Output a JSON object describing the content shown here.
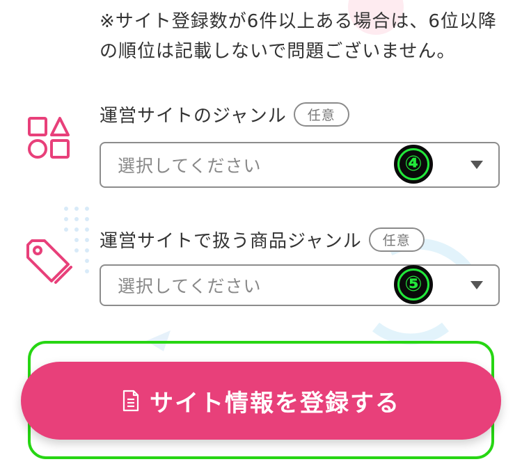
{
  "notice": "※サイト登録数が6件以上ある場合は、6位以降の順位は記載しないで問題ございません。",
  "fields": [
    {
      "label": "運営サイトのジャンル",
      "badge": "任意",
      "placeholder": "選択してください",
      "icon": "shapes-icon",
      "marker": "④"
    },
    {
      "label": "運営サイトで扱う商品ジャンル",
      "badge": "任意",
      "placeholder": "選択してください",
      "icon": "price-tag-icon",
      "marker": "⑤"
    }
  ],
  "submit": {
    "label": "サイト情報を登録する",
    "icon": "document-icon"
  },
  "colors": {
    "accent": "#e8407a",
    "highlight": "#27d613",
    "marker_ring": "#22e83a"
  }
}
